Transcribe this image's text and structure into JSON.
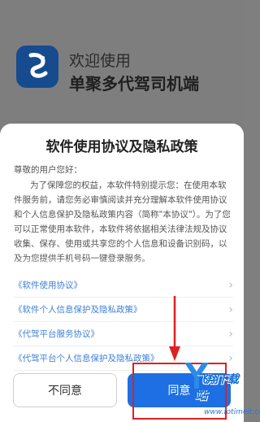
{
  "header": {
    "welcome": "欢迎使用",
    "app_name": "单聚多代驾司机端"
  },
  "dialog": {
    "title": "软件使用协议及隐私政策",
    "greeting": "尊敬的用户您好：",
    "body": "为了保障您的权益，本软件特别提示您：在使用本软件服务前，请您务必审慎阅读并充分理解本软件使用协议和个人信息保护及隐私政策内容（简称\"本协议\"）。为了您可以正常使用本软件，本软件将依据相关法律法规及协议收集、保存、使用或共享您的个人信息和设备识别码，以及为您提供手机号码一键登录服务。",
    "links": [
      {
        "label": "《软件使用协议》"
      },
      {
        "label": "《软件个人信息保护及隐私政策》"
      },
      {
        "label": "《代驾平台服务协议》"
      },
      {
        "label": "《代驾平台个人信息保护及隐私政策》"
      }
    ],
    "disagree_label": "不同意",
    "agree_label": "同意"
  },
  "watermark": {
    "text": "飞翔下载站",
    "url": "www.fotimeit.com"
  },
  "colors": {
    "accent": "#1e6fe3",
    "link": "#3d7fd8",
    "highlight": "#e02020"
  }
}
